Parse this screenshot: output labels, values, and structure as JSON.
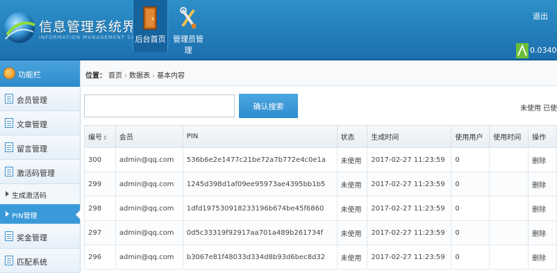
{
  "header": {
    "title": "信息管理系统界面",
    "subtitle": "INFORMATION MANAGEMENT SYSTEM INT",
    "nav": [
      {
        "label": "后台首页",
        "icon": "door-icon"
      },
      {
        "label": "管理员管理",
        "icon": "tools-icon"
      }
    ],
    "logout": "退出",
    "user_value": "0.0340"
  },
  "sidebar": {
    "title": "功能栏",
    "items": [
      {
        "label": "会员管理"
      },
      {
        "label": "文章管理"
      },
      {
        "label": "留言管理"
      },
      {
        "label": "激活码管理"
      }
    ],
    "subitems": [
      {
        "label": "生成激活码"
      },
      {
        "label": "PIN管理"
      }
    ],
    "items_after": [
      {
        "label": "奖金管理"
      },
      {
        "label": "匹配系统"
      }
    ]
  },
  "breadcrumb": {
    "prefix": "位置：",
    "items": [
      "首页",
      "数据表",
      "基本内容"
    ]
  },
  "search": {
    "placeholder": "",
    "button": "确认搜索",
    "legend": "未使用 已使用"
  },
  "table": {
    "headers": [
      "编号",
      "会员",
      "PIN",
      "状态",
      "生成时间",
      "使用用户",
      "使用时间",
      "操作"
    ],
    "rows": [
      [
        "300",
        "admin@qq.com",
        "536b6e2e1477c21be72a7b772e4c0e1a",
        "未使用",
        "2017-02-27 11:23:59",
        "0",
        "",
        "删除"
      ],
      [
        "299",
        "admin@qq.com",
        "1245d398d1af09ee95973ae4395bb1b5",
        "未使用",
        "2017-02-27 11:23:59",
        "0",
        "",
        "删除"
      ],
      [
        "298",
        "admin@qq.com",
        "1dfd197530918233196b674be45f6860",
        "未使用",
        "2017-02-27 11:23:59",
        "0",
        "",
        "删除"
      ],
      [
        "297",
        "admin@qq.com",
        "0d5c33319f92917aa701a489b261734f",
        "未使用",
        "2017-02-27 11:23:59",
        "0",
        "",
        "删除"
      ],
      [
        "296",
        "admin@qq.com",
        "b3067e81f48033d334d8b93d6bec8d32",
        "未使用",
        "2017-02-27 11:23:59",
        "0",
        "",
        "删除"
      ]
    ]
  },
  "colors": {
    "header_blue": "#2d90c9",
    "accent_blue": "#3a9ad9"
  }
}
